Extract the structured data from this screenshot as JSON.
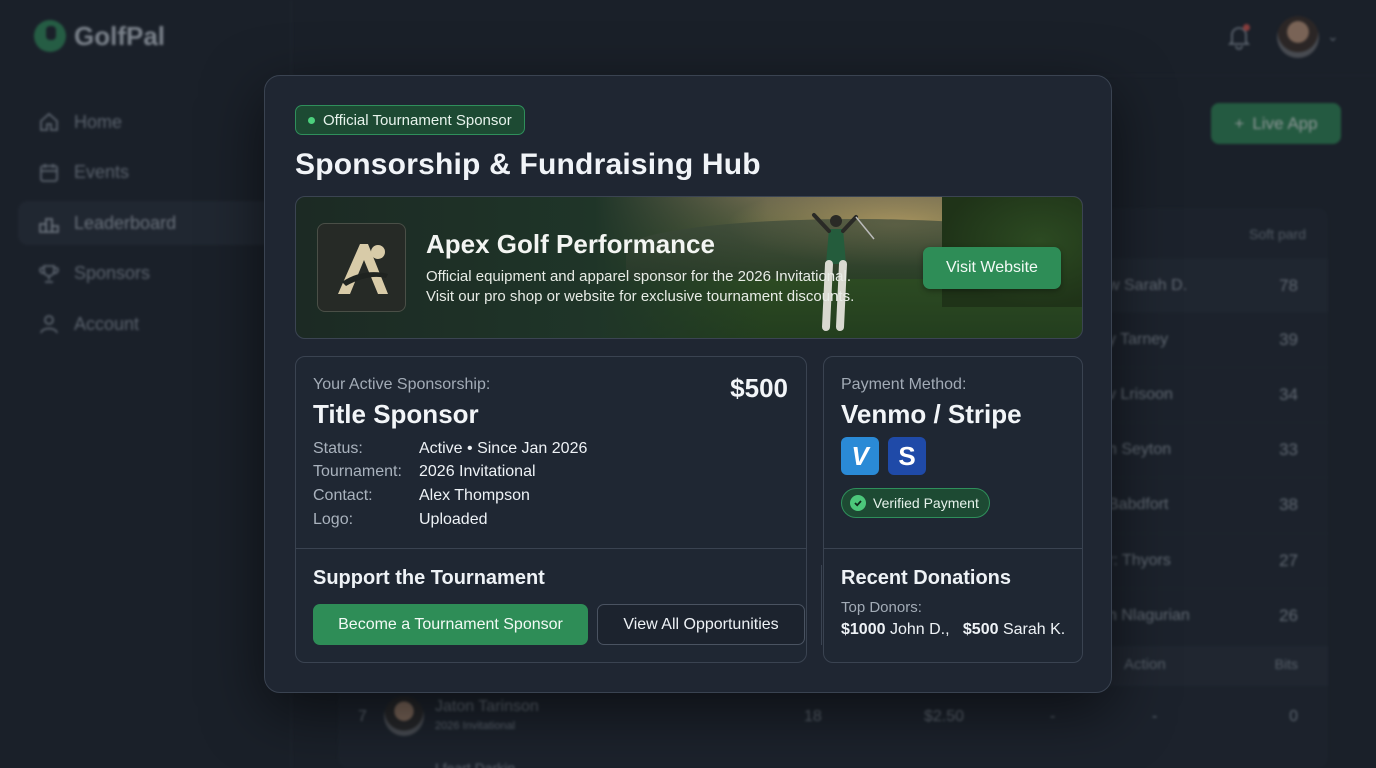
{
  "app": {
    "name": "GolfPal"
  },
  "sidebar": {
    "items": [
      {
        "label": "Home",
        "icon": "home-icon"
      },
      {
        "label": "Events",
        "icon": "calendar-icon"
      },
      {
        "label": "Leaderboard",
        "icon": "leaderboard-icon"
      },
      {
        "label": "Sponsors",
        "icon": "trophy-icon"
      },
      {
        "label": "Account",
        "icon": "user-icon"
      }
    ]
  },
  "header": {
    "live_app_label": "Live App"
  },
  "table": {
    "column_right": "Soft pard",
    "rows": [
      {
        "name": "w Sarah D.",
        "value": "78"
      },
      {
        "name": "y Tarney",
        "value": "39"
      },
      {
        "name": "v Lrisoon",
        "value": "34"
      },
      {
        "name": "n Seyton",
        "value": "33"
      },
      {
        "name": "Babdfort",
        "value": "38"
      },
      {
        "name": "r: Thyors",
        "value": "27"
      },
      {
        "name": "n Nlagurian",
        "value": "26"
      }
    ],
    "subheader": {
      "action": "Action",
      "bits": "Bits"
    },
    "bottom_row": {
      "rank": "7",
      "name": "Jaton Tarinson",
      "event": "2026 Invitational",
      "holes": "18",
      "amount": "$2.50",
      "dash1": "-",
      "dash2": "-",
      "value": "0"
    },
    "next_row_name": "Lfeart Darkin"
  },
  "modal": {
    "badge": "Official Tournament Sponsor",
    "title": "Sponsorship & Fundraising Hub",
    "sponsor": {
      "name": "Apex Golf Performance",
      "description_line1": "Official equipment and apparel sponsor for the 2026 Invitational.",
      "description_line2": "Visit our pro shop or website for exclusive tournament discounts.",
      "visit_label": "Visit Website"
    },
    "active": {
      "label": "Your Active Sponsorship:",
      "tier": "Title Sponsor",
      "amount": "$500",
      "details": [
        {
          "key": "Status:",
          "value": "Active • Since Jan 2026"
        },
        {
          "key": "Tournament:",
          "value": "2026 Invitational"
        },
        {
          "key": "Contact:",
          "value": "Alex Thompson"
        },
        {
          "key": "Logo:",
          "value": "Uploaded"
        }
      ]
    },
    "payment": {
      "label": "Payment Method:",
      "method": "Venmo / Stripe",
      "venmo_glyph": "V",
      "stripe_glyph": "S",
      "verified": "Verified Payment"
    },
    "support": {
      "title": "Support the Tournament",
      "primary_label": "Become a Tournament Sponsor",
      "secondary_label": "View All Opportunities"
    },
    "donations": {
      "title": "Recent Donations",
      "label": "Top Donors:",
      "d1_amount": "$1000",
      "d1_name": "John D.,",
      "d2_amount": "$500",
      "d2_name": "Sarah K."
    }
  },
  "colors": {
    "accent": "#2e8d57",
    "badge_bg": "#1d4a33",
    "venmo": "#2a8ad6",
    "stripe": "#1f4aa8"
  }
}
